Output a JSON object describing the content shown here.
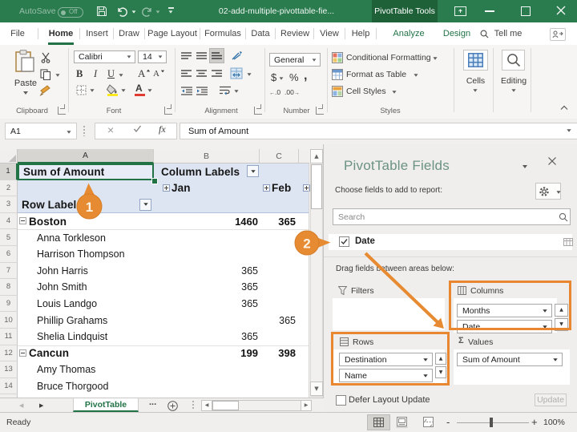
{
  "titlebar": {
    "autosave_label": "AutoSave",
    "autosave_state": "Off",
    "document_title": "02-add-multiple-pivottable-fie...",
    "contextual_tab_group": "PivotTable Tools"
  },
  "tabs": {
    "file": "File",
    "home": "Home",
    "insert": "Insert",
    "draw": "Draw",
    "page_layout": "Page Layout",
    "formulas": "Formulas",
    "data": "Data",
    "review": "Review",
    "view": "View",
    "help": "Help",
    "analyze": "Analyze",
    "design": "Design",
    "tell_me": "Tell me"
  },
  "ribbon": {
    "clipboard": {
      "label": "Clipboard",
      "paste": "Paste"
    },
    "font": {
      "label": "Font",
      "font_name": "Calibri",
      "font_size": "14",
      "bold": "B",
      "italic": "I",
      "underline": "U",
      "grow": "A",
      "shrink": "A",
      "color": "A"
    },
    "alignment": {
      "label": "Alignment"
    },
    "number": {
      "label": "Number",
      "format": "General",
      "currency": "$",
      "percent": "%",
      "comma": ",",
      "inc_dec": ".0",
      "dec_dec": ".00"
    },
    "styles": {
      "label": "Styles",
      "conditional": "Conditional Formatting",
      "format_table": "Format as Table",
      "cell_styles": "Cell Styles"
    },
    "cells": {
      "label": "Cells"
    },
    "editing": {
      "label": "Editing"
    }
  },
  "formula_bar": {
    "name_box": "A1",
    "fx": "fx",
    "content": "Sum of Amount"
  },
  "grid": {
    "col_a": "A",
    "col_b": "B",
    "col_c": "C",
    "rows": [
      {
        "n": "1",
        "a": "Sum of Amount",
        "b": "Column Labels",
        "c": ""
      },
      {
        "n": "2",
        "a": "",
        "b": "Jan",
        "c": "Feb"
      },
      {
        "n": "3",
        "a": "Row Labels",
        "b": "",
        "c": ""
      },
      {
        "n": "4",
        "a": "Boston",
        "b": "1460",
        "c": "365"
      },
      {
        "n": "5",
        "a": "Anna Torkleson",
        "b": "",
        "c": ""
      },
      {
        "n": "6",
        "a": "Harrison Thompson",
        "b": "",
        "c": ""
      },
      {
        "n": "7",
        "a": "John Harris",
        "b": "365",
        "c": ""
      },
      {
        "n": "8",
        "a": "John Smith",
        "b": "365",
        "c": ""
      },
      {
        "n": "9",
        "a": "Louis Landgo",
        "b": "365",
        "c": ""
      },
      {
        "n": "10",
        "a": "Phillip Grahams",
        "b": "",
        "c": "365"
      },
      {
        "n": "11",
        "a": "Shelia Lindquist",
        "b": "365",
        "c": ""
      },
      {
        "n": "12",
        "a": "Cancun",
        "b": "199",
        "c": "398"
      },
      {
        "n": "13",
        "a": "Amy Thomas",
        "b": "",
        "c": ""
      },
      {
        "n": "14",
        "a": "Bruce Thorgood",
        "b": "",
        "c": ""
      }
    ]
  },
  "sheet_tabs": {
    "active": "PivotTable",
    "more": "..."
  },
  "status_bar": {
    "mode": "Ready",
    "zoom": "100%",
    "zoom_out": "-",
    "zoom_in": "+"
  },
  "panel": {
    "title": "PivotTable Fields",
    "subtitle": "Choose fields to add to report:",
    "search_placeholder": "Search",
    "field_date": "Date",
    "drag_hint": "Drag fields between areas below:",
    "areas": {
      "filters": "Filters",
      "columns": "Columns",
      "rows": "Rows",
      "values": "Values"
    },
    "columns_fields": [
      "Months",
      "Date"
    ],
    "rows_fields": [
      "Destination",
      "Name"
    ],
    "values_fields": [
      "Sum of Amount"
    ],
    "defer_label": "Defer Layout Update",
    "update_label": "Update"
  },
  "callouts": {
    "one": "1",
    "two": "2"
  },
  "colors": {
    "accent_green": "#217346",
    "callout_orange": "#e8872f",
    "pivot_header_blue": "#dee5f2"
  }
}
